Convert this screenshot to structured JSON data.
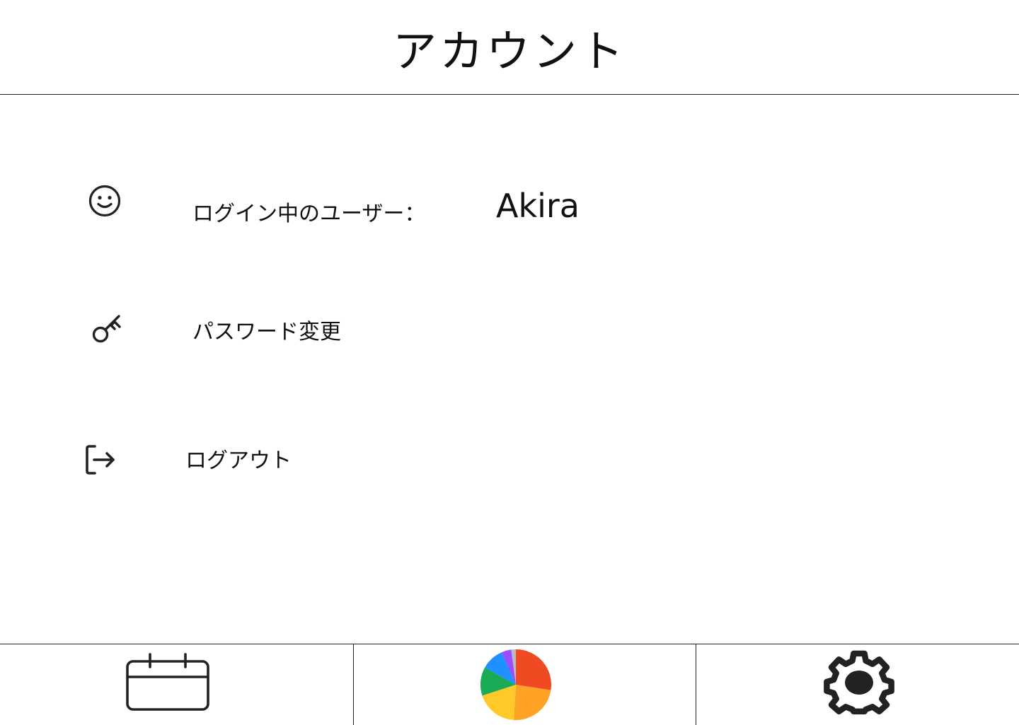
{
  "header": {
    "title": "アカウント"
  },
  "account": {
    "user_row": {
      "icon": "smiley-icon",
      "label": "ログイン中のユーザー：",
      "value": "Akira"
    },
    "password_row": {
      "icon": "key-icon",
      "label": "パスワード変更"
    },
    "logout_row": {
      "icon": "logout-icon",
      "label": "ログアウト"
    }
  },
  "tab_bar": {
    "tabs": [
      {
        "icon": "calendar-icon"
      },
      {
        "icon": "pie-chart-icon"
      },
      {
        "icon": "gear-icon"
      }
    ]
  },
  "colors": {
    "text": "#111111",
    "divider": "#222222",
    "pie_red": "#F04A23",
    "pie_orange": "#FFA225",
    "pie_yellow": "#FFCA28",
    "pie_green": "#1BAA55",
    "pie_blue": "#1E90FF",
    "pie_purple": "#9B4DFF",
    "pie_gray": "#BBBBBB"
  }
}
